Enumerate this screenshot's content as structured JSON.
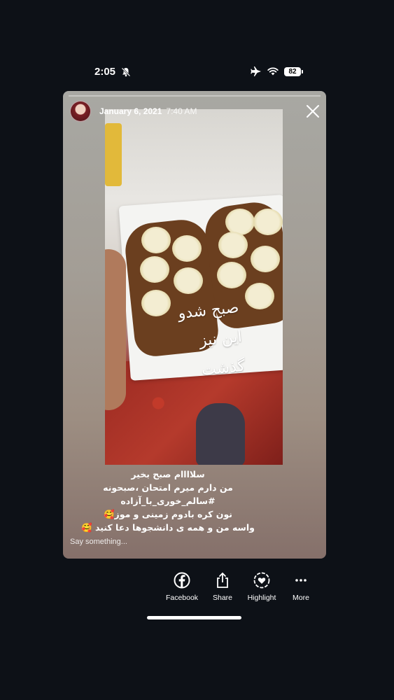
{
  "status_bar": {
    "time": "2:05",
    "battery": "82",
    "icons": [
      "bell-muted-icon",
      "airplane-icon",
      "wifi-icon",
      "battery-icon"
    ]
  },
  "story": {
    "date": "January 6, 2021",
    "time": "7:40 AM",
    "overlay_text": [
      "صبح شدو",
      "این نیز",
      "گذشت"
    ],
    "caption_lines": [
      "سلاااام صبح بخیر",
      "من دارم میرم امتحان ،صبحونه",
      "#سالم_خوری_با_آزاده",
      "نون کره بادوم زمینی و موز🥰",
      "واسه من و همه ی دانشجوها دعا کنید 🥰"
    ],
    "reply_placeholder": "Say something..."
  },
  "actions": [
    {
      "label": "Facebook",
      "icon": "facebook-icon"
    },
    {
      "label": "Share",
      "icon": "share-icon"
    },
    {
      "label": "Highlight",
      "icon": "highlight-heart-icon"
    },
    {
      "label": "More",
      "icon": "more-dots-icon"
    }
  ],
  "colors": {
    "background": "#0d1117",
    "text": "#ffffff"
  }
}
